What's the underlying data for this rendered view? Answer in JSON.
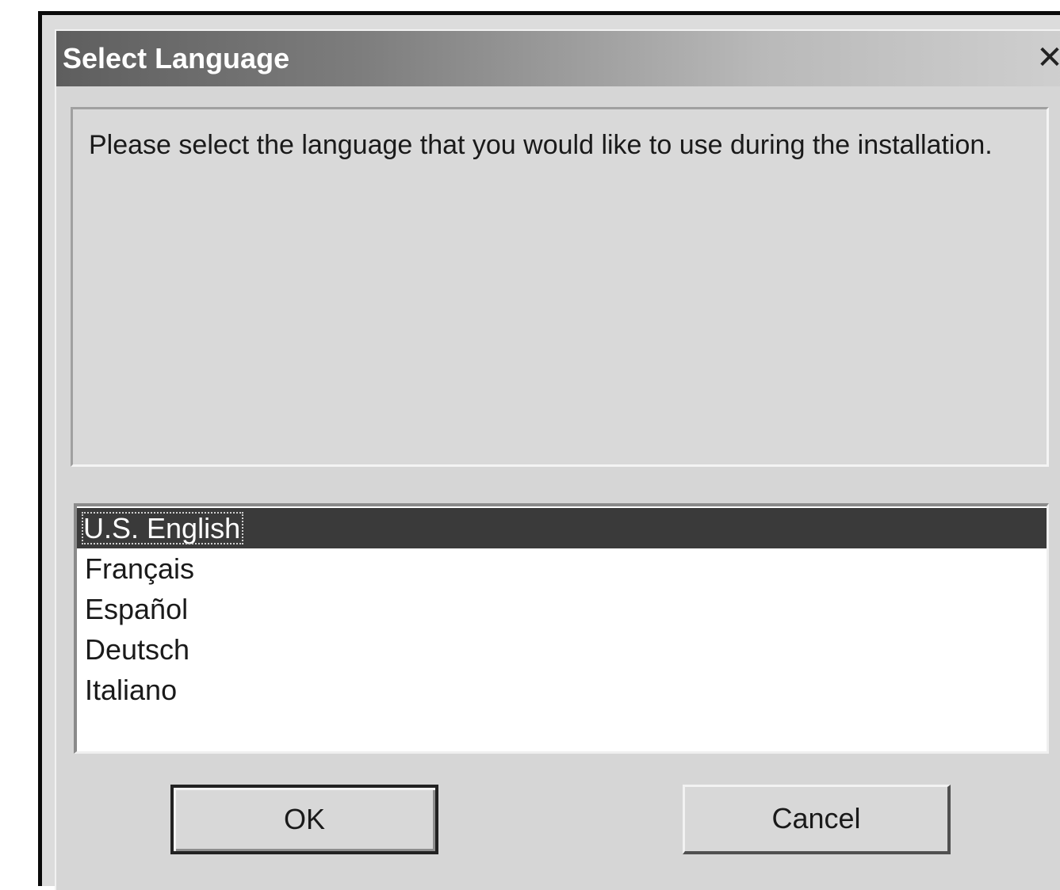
{
  "window": {
    "title": "Select Language",
    "close_glyph": "✕"
  },
  "message": "Please select the language that you would like to use during the installation.",
  "languages": {
    "selected_index": 0,
    "items": [
      "U.S. English",
      "Français",
      "Español",
      "Deutsch",
      "Italiano"
    ]
  },
  "buttons": {
    "ok_label": "OK",
    "cancel_label": "Cancel"
  },
  "colors": {
    "selection": "#3a3a3a",
    "dialog_face": "#d6d6d6"
  }
}
